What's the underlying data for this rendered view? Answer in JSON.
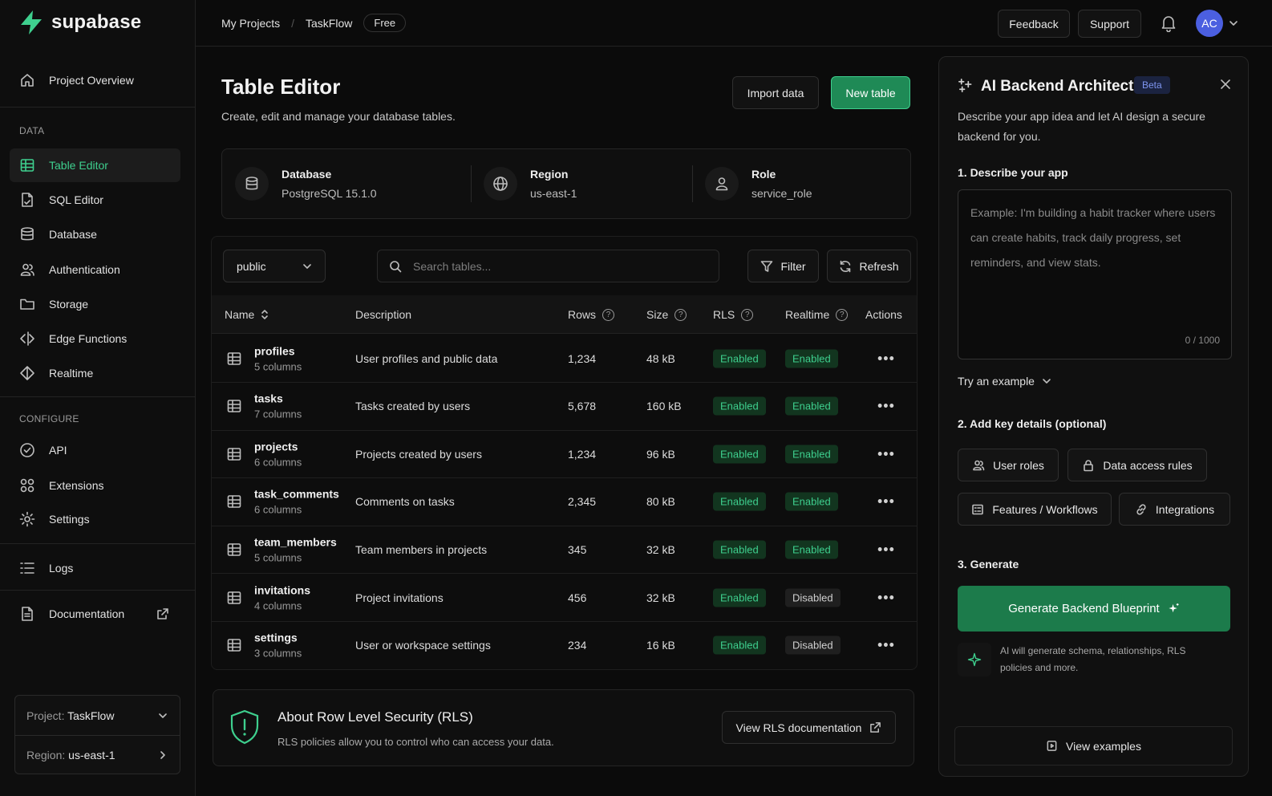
{
  "app": {
    "name": "supabase",
    "brand_color": "#3ecf8e"
  },
  "sidebar": {
    "overview": "Project Overview",
    "sections": {
      "data": "DATA",
      "configure": "CONFIGURE"
    },
    "data_items": [
      {
        "label": "Table Editor",
        "icon": "table-icon",
        "active": true
      },
      {
        "label": "SQL Editor",
        "icon": "sql-file-icon"
      },
      {
        "label": "Database",
        "icon": "database-icon"
      },
      {
        "label": "Authentication",
        "icon": "users-icon"
      },
      {
        "label": "Storage",
        "icon": "folder-icon"
      },
      {
        "label": "Edge Functions",
        "icon": "code-icon"
      },
      {
        "label": "Realtime",
        "icon": "realtime-icon"
      }
    ],
    "configure_items": [
      {
        "label": "API",
        "icon": "api-icon"
      },
      {
        "label": "Extensions",
        "icon": "extensions-icon"
      },
      {
        "label": "Settings",
        "icon": "gear-icon"
      }
    ],
    "logs": "Logs",
    "documentation": "Documentation",
    "project_label": "Project:",
    "project_value": "TaskFlow",
    "region_label": "Region:",
    "region_value": "us-east-1"
  },
  "topbar": {
    "breadcrumb": [
      "My Projects",
      "TaskFlow"
    ],
    "plan_badge": "Free",
    "feedback": "Feedback",
    "support": "Support",
    "avatar_initials": "AC"
  },
  "main": {
    "title": "Table Editor",
    "subtitle": "Create, edit and manage your database tables.",
    "import_button": "Import data",
    "new_table_button": "New table",
    "info": [
      {
        "label": "Database",
        "value": "PostgreSQL 15.1.0",
        "icon": "database-icon"
      },
      {
        "label": "Region",
        "value": "us-east-1",
        "icon": "globe-icon"
      },
      {
        "label": "Role",
        "value": "service_role",
        "icon": "user-icon"
      }
    ],
    "schema_select": "public",
    "search_placeholder": "Search tables...",
    "filter_button": "Filter",
    "refresh_button": "Refresh",
    "columns": [
      "Name",
      "Description",
      "Rows",
      "Size",
      "RLS",
      "Realtime",
      "Actions"
    ],
    "rows": [
      {
        "name": "profiles",
        "cols": "5 columns",
        "description": "User profiles and public data",
        "rows": "1,234",
        "size": "48 kB",
        "rls": "Enabled",
        "realtime": "Enabled"
      },
      {
        "name": "tasks",
        "cols": "7 columns",
        "description": "Tasks created by users",
        "rows": "5,678",
        "size": "160 kB",
        "rls": "Enabled",
        "realtime": "Enabled"
      },
      {
        "name": "projects",
        "cols": "6 columns",
        "description": "Projects created by users",
        "rows": "1,234",
        "size": "96 kB",
        "rls": "Enabled",
        "realtime": "Enabled"
      },
      {
        "name": "task_comments",
        "cols": "6 columns",
        "description": "Comments on tasks",
        "rows": "2,345",
        "size": "80 kB",
        "rls": "Enabled",
        "realtime": "Enabled"
      },
      {
        "name": "team_members",
        "cols": "5 columns",
        "description": "Team members in projects",
        "rows": "345",
        "size": "32 kB",
        "rls": "Enabled",
        "realtime": "Enabled"
      },
      {
        "name": "invitations",
        "cols": "4 columns",
        "description": "Project invitations",
        "rows": "456",
        "size": "32 kB",
        "rls": "Enabled",
        "realtime": "Disabled"
      },
      {
        "name": "settings",
        "cols": "3 columns",
        "description": "User or workspace settings",
        "rows": "234",
        "size": "16 kB",
        "rls": "Enabled",
        "realtime": "Disabled"
      }
    ],
    "rls": {
      "title": "About Row Level Security (RLS)",
      "text": "RLS policies allow you to control who can access your data.",
      "button": "View RLS documentation"
    }
  },
  "ai": {
    "title": "AI Backend Architect",
    "badge": "Beta",
    "description": "Describe your app idea and let AI design a secure backend for you.",
    "step1": "1. Describe your app",
    "placeholder": "Example: I'm building a habit tracker where users can create habits, track daily progress, set reminders, and view stats.",
    "counter": "0 / 1000",
    "try_example": "Try an example",
    "step2": "2. Add key details (optional)",
    "chips": [
      "User roles",
      "Data access rules",
      "Features / Workflows",
      "Integrations"
    ],
    "step3": "3. Generate",
    "generate_button": "Generate Backend Blueprint",
    "note": "AI will generate schema, relationships, RLS policies and more.",
    "view_examples": "View examples"
  }
}
